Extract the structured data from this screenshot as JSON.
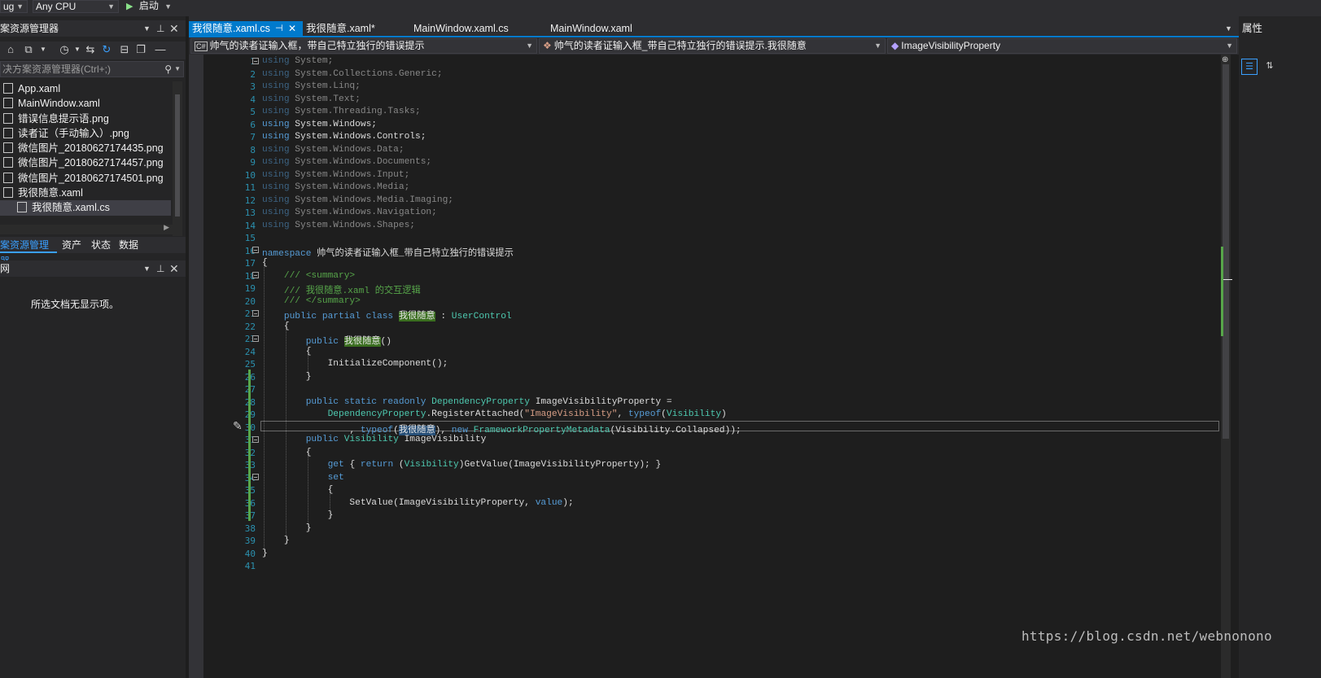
{
  "toolbar": {
    "config": "ug",
    "platform": "Any CPU",
    "start": "启动"
  },
  "solution_explorer": {
    "title": "案资源管理器",
    "search_placeholder": "决方案资源管理器(Ctrl+;)",
    "items": [
      {
        "label": "App.xaml",
        "icon": "xaml-file-icon"
      },
      {
        "label": "MainWindow.xaml",
        "icon": "xaml-file-icon"
      },
      {
        "label": "错误信息提示语.png",
        "icon": "image-file-icon"
      },
      {
        "label": "读者证（手动输入）.png",
        "icon": "image-file-icon"
      },
      {
        "label": "微信图片_20180627174435.png",
        "icon": "image-file-icon"
      },
      {
        "label": "微信图片_20180627174457.png",
        "icon": "image-file-icon"
      },
      {
        "label": "微信图片_20180627174501.png",
        "icon": "image-file-icon"
      },
      {
        "label": "我很随意.xaml",
        "icon": "xaml-file-icon"
      },
      {
        "label": "我很随意.xaml.cs",
        "icon": "cs-file-icon"
      }
    ],
    "bottom_tabs": [
      "案资源管理器",
      "资产",
      "状态",
      "数据"
    ]
  },
  "lower_panel": {
    "title": "网",
    "empty_message": "所选文档无显示项。"
  },
  "tabs": [
    {
      "label": "我很随意.xaml.cs",
      "active": true
    },
    {
      "label": "我很随意.xaml*",
      "active": false
    },
    {
      "label": "MainWindow.xaml.cs",
      "active": false
    },
    {
      "label": "MainWindow.xaml",
      "active": false
    }
  ],
  "navbar": {
    "project": "帅气的读者证输入框，带自己特立独行的错误提示",
    "type": "帅气的读者证输入框_带自己特立独行的错误提示.我很随意",
    "member": "ImageVisibilityProperty"
  },
  "properties": {
    "title": "属性"
  },
  "code": {
    "line_numbers": [
      "1",
      "2",
      "3",
      "4",
      "5",
      "6",
      "7",
      "8",
      "9",
      "10",
      "11",
      "12",
      "13",
      "14",
      "15",
      "16",
      "17",
      "18",
      "19",
      "20",
      "21",
      "22",
      "23",
      "24",
      "25",
      "26",
      "27",
      "28",
      "29",
      "30",
      "31",
      "32",
      "33",
      "34",
      "35",
      "36",
      "37",
      "38",
      "39",
      "40",
      "41"
    ],
    "l1": "System;",
    "l2": "System.Collections.Generic;",
    "l3": "System.Linq;",
    "l4": "System.Text;",
    "l5": "System.Threading.Tasks;",
    "l6": "System.Windows;",
    "l7": "System.Windows.Controls;",
    "l8": "System.Windows.Data;",
    "l9": "System.Windows.Documents;",
    "l10": "System.Windows.Input;",
    "l11": "System.Windows.Media;",
    "l12": "System.Windows.Media.Imaging;",
    "l13": "System.Windows.Navigation;",
    "l14": "System.Windows.Shapes;",
    "namespace_name": "帅气的读者证输入框_带自己特立独行的错误提示",
    "summary_open": "/// <summary>",
    "summary_text": "/// 我很随意.xaml 的交互逻辑",
    "summary_close": "/// </summary>",
    "class_name": "我很随意",
    "base_class": "UserControl",
    "init_call": "InitializeComponent();",
    "dp_type": "DependencyProperty",
    "dp_name": "ImageVisibilityProperty =",
    "register": "RegisterAttached(",
    "prop_string": "\"ImageVisibility\"",
    "visibility": "Visibility",
    "framework_meta": "FrameworkPropertyMetadata",
    "collapsed": "(Visibility.Collapsed));",
    "prop_name": "ImageVisibility",
    "getter": "GetValue(ImageVisibilityProperty); }",
    "setter": "SetValue(ImageVisibilityProperty,"
  },
  "watermark": "https://blog.csdn.net/webnonono"
}
